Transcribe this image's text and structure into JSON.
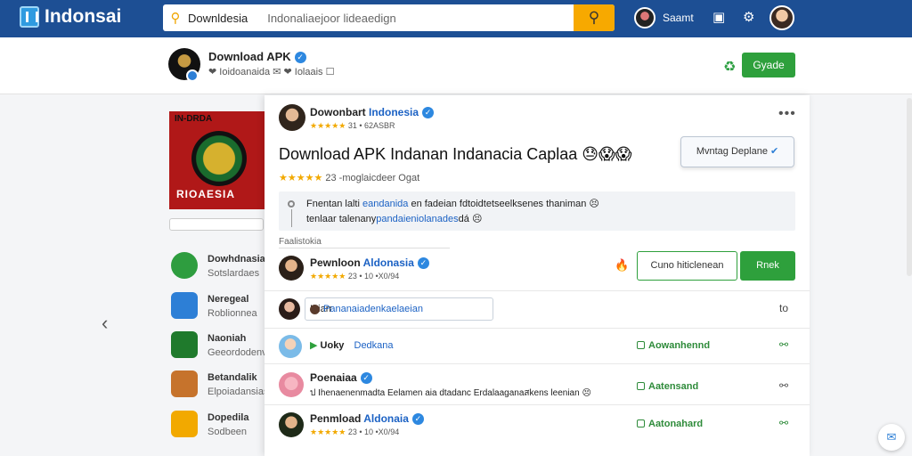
{
  "topbar": {
    "brand": "Indonsai",
    "search_label": "Downldesia",
    "search_value": "Indonaliaejoor lideaedign",
    "user_name": "Saamt",
    "icons": [
      "search-icon",
      "device-icon",
      "gear-icon"
    ]
  },
  "profile": {
    "name": "Download APK",
    "subtitle": "❤ Ioidoanaida ✉ ❤ Iolaais ☐",
    "follow_label": "Gyade"
  },
  "sidebar": {
    "tile_top": "IN-DRDA",
    "tile_text": "RIOAESIA",
    "items": [
      {
        "title": "Dowhdnasian",
        "sub": "Sotslardaes",
        "color": "#2e9d3f"
      },
      {
        "title": "Neregeal",
        "sub": "Roblionnea",
        "color": "#2d7fd6"
      },
      {
        "title": "Naoniah",
        "sub": "Geeordodenvian",
        "color": "#1f7a2c"
      },
      {
        "title": "Betandalik",
        "sub": "Elpoiadansias",
        "color": "#c6732c"
      },
      {
        "title": "Dopedila",
        "sub": "Sodbeen",
        "color": "#f2a900"
      }
    ]
  },
  "post": {
    "author_plain": "Dowonbart",
    "author_blue": "Indonesia",
    "meta": "31 • 62ASBR",
    "more": "•••",
    "title": "Download APK Indanan Indanacia Caplaa 😓😱😱",
    "rating_text": "23 -moglaicdeer Ogat",
    "dropdown_label": "Mvntag Deplane",
    "quote_line1_a": "Fnentan lalti",
    "quote_line1_blue": "eandanida",
    "quote_line1_b": "en fadeian fdtoidtetseelksenes thaniman 😣",
    "quote_line2_a": "tenlaar talenany",
    "quote_line2_blue": "pandaieniolanades",
    "quote_line2_b": "dá 😣",
    "section_label": "Faalistokia"
  },
  "rows": [
    {
      "name_plain": "Pewnloon",
      "name_blue": "Aldonasia",
      "meta": "23 • 10 •X0/94",
      "outline_btn": "Cuno hiticlenean",
      "solid_btn": "Rnek"
    },
    {
      "name": "Iaiarr",
      "input_text": "Pananaiadenkaelaeian",
      "end": "to"
    },
    {
      "name": "Uoky",
      "name_blue": "Dedkana",
      "action": "Aowanhennd"
    },
    {
      "name": "Poenaiaa",
      "meta": "ป Ihenaenenmadta Eelamen aia dtadanc Erdalaaganaสkens leenian 😣",
      "action": "Aatensand"
    },
    {
      "name_plain": "Penmload",
      "name_blue": "Aldonaia",
      "meta": "23 • 10 •X0/94",
      "action": "Aatonahard"
    }
  ],
  "colors": {
    "topbar": "#1d4f94",
    "accent_green": "#2ea03c",
    "accent_orange": "#f7a900",
    "link_blue": "#1c62c4"
  }
}
